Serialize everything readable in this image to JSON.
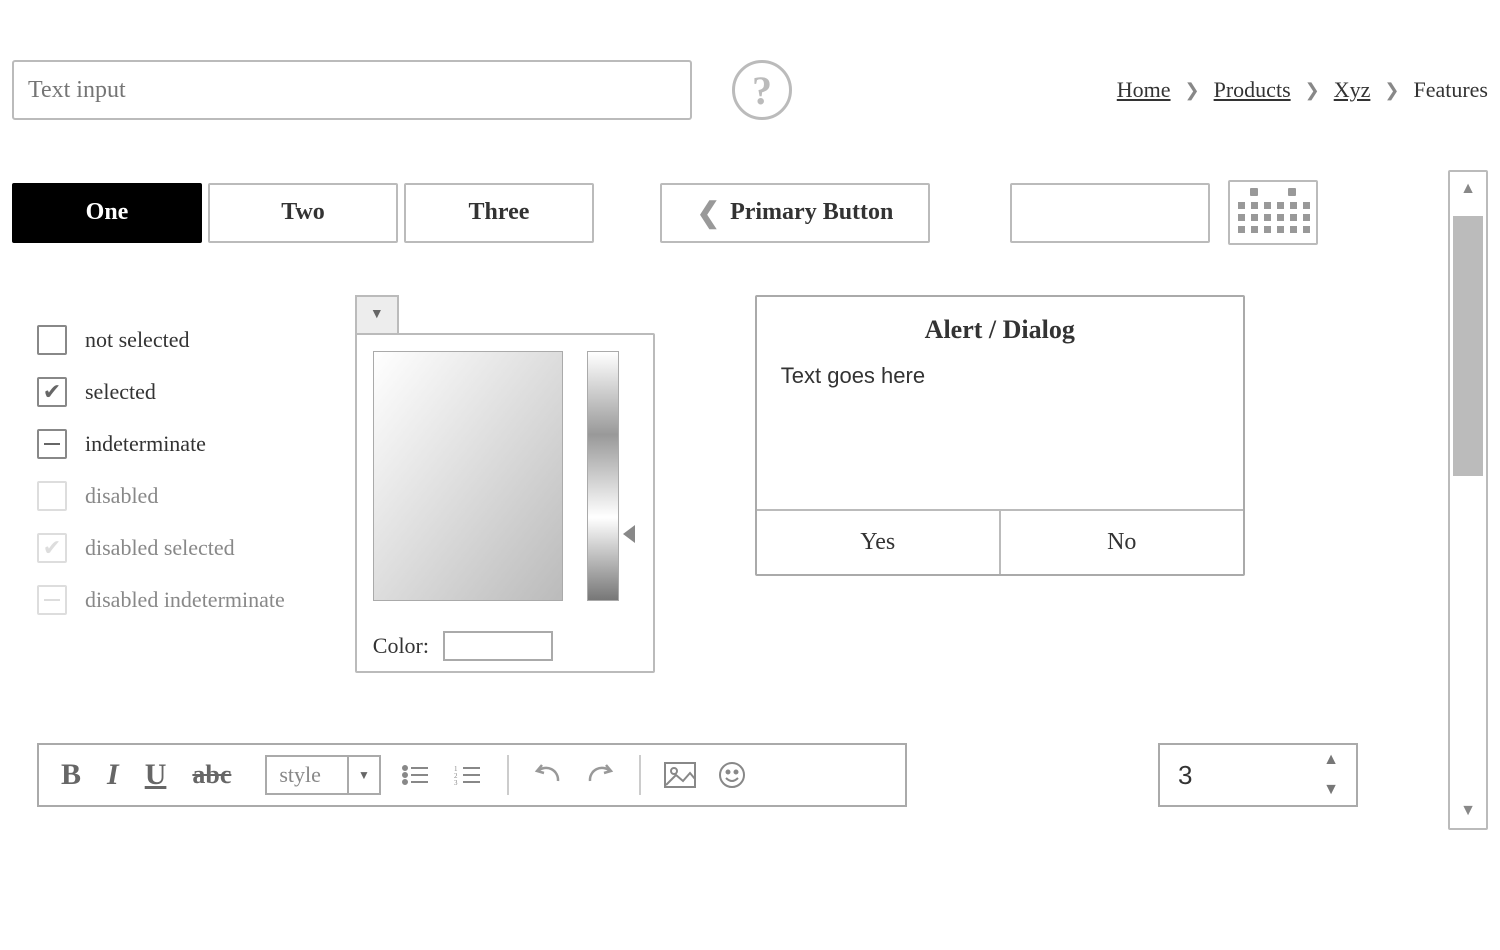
{
  "textInput": {
    "placeholder": "Text input",
    "value": ""
  },
  "breadcrumb": {
    "items": [
      "Home",
      "Products",
      "Xyz",
      "Features"
    ]
  },
  "tabs": {
    "items": [
      "One",
      "Two",
      "Three"
    ],
    "active": 0
  },
  "primaryButton": {
    "label": "Primary Button"
  },
  "checkboxes": {
    "items": [
      {
        "label": "not selected",
        "state": "unchecked",
        "disabled": false
      },
      {
        "label": "selected",
        "state": "checked",
        "disabled": false
      },
      {
        "label": "indeterminate",
        "state": "indeterminate",
        "disabled": false
      },
      {
        "label": "disabled",
        "state": "unchecked",
        "disabled": true
      },
      {
        "label": "disabled selected",
        "state": "checked",
        "disabled": true
      },
      {
        "label": "disabled indeterminate",
        "state": "indeterminate",
        "disabled": true
      }
    ]
  },
  "colorPicker": {
    "label": "Color:"
  },
  "dialog": {
    "title": "Alert / Dialog",
    "body": "Text goes here",
    "yes": "Yes",
    "no": "No"
  },
  "toolbar": {
    "bold": "B",
    "italic": "I",
    "underline": "U",
    "strike": "abc",
    "styleLabel": "style"
  },
  "stepper": {
    "value": "3"
  }
}
